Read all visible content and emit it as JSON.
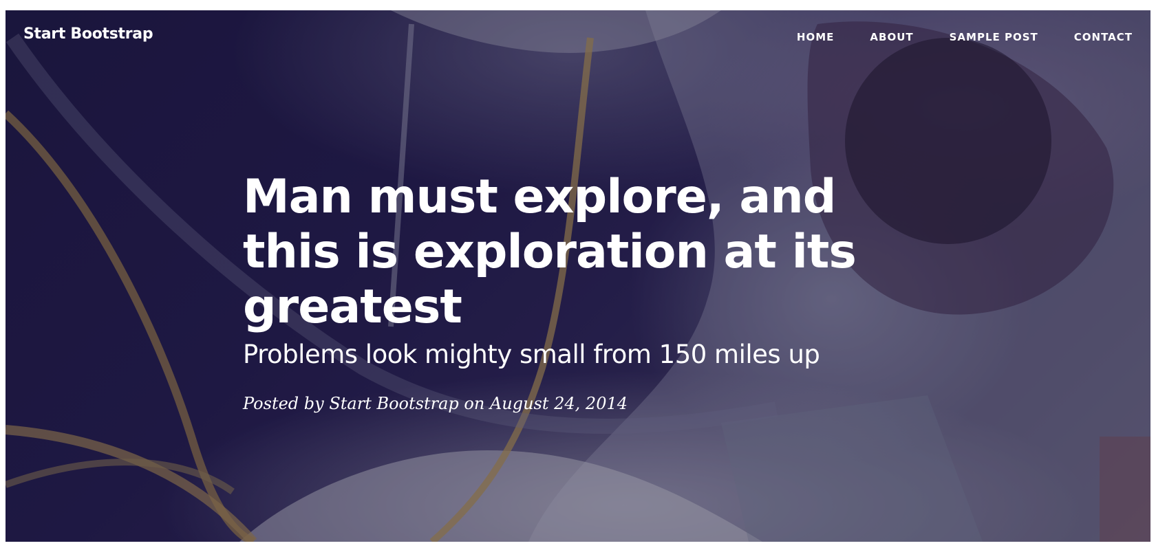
{
  "navbar": {
    "brand": "Start Bootstrap",
    "links": [
      {
        "label": "HOME"
      },
      {
        "label": "ABOUT"
      },
      {
        "label": "SAMPLE POST"
      },
      {
        "label": "CONTACT"
      }
    ]
  },
  "post": {
    "title": "Man must explore, and this is exploration at its greatest",
    "subtitle": "Problems look mighty small from 150 miles up",
    "meta": "Posted by Start Bootstrap on August 24, 2014"
  },
  "colors": {
    "text": "#ffffff",
    "space": "#1d1840"
  }
}
